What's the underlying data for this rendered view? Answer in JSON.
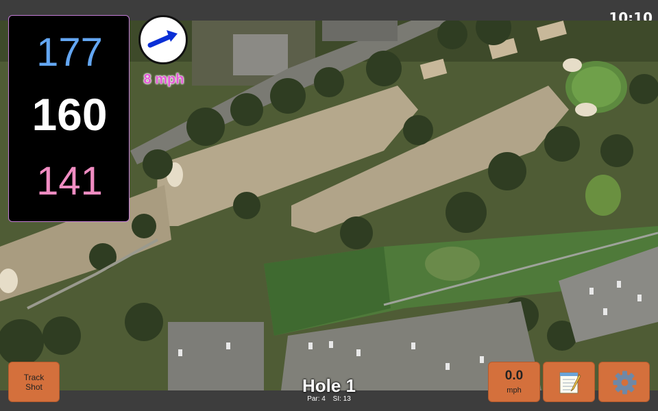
{
  "status": {
    "time": "10:10"
  },
  "distances": {
    "back": "177",
    "center": "160",
    "front": "141"
  },
  "wind": {
    "speed": "8 mph",
    "icon": "wind-direction-arrow-icon"
  },
  "hole": {
    "title": "Hole 1",
    "par": "Par: 4",
    "si": "SI: 13"
  },
  "buttons": {
    "track_shot_line1": "Track",
    "track_shot_line2": "Shot",
    "speed_value": "0.0",
    "speed_unit": "mph",
    "notes_icon": "notepad-icon",
    "settings_icon": "gear-icon"
  },
  "colors": {
    "back": "#63a6f2",
    "center": "#ffffff",
    "front": "#f08cc2",
    "wind_text": "#e45ad6",
    "button": "#d4703c",
    "card_border": "#c27bd6"
  }
}
